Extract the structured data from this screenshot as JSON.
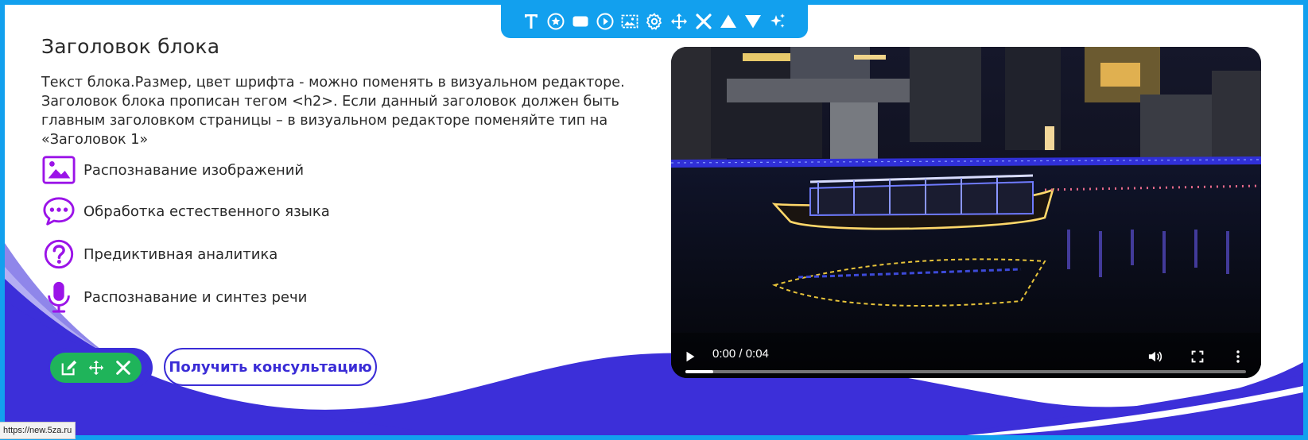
{
  "colors": {
    "accent": "#12a0ee",
    "purple": "#9b13e8",
    "wave": "#3c2fd9",
    "green": "#1fb45a"
  },
  "toolbar": {
    "icons": [
      "text-icon",
      "star-icon",
      "shape-icon",
      "play-icon",
      "image-icon",
      "gear-icon",
      "move-icon",
      "close-icon",
      "arrow-up-icon",
      "arrow-down-icon",
      "sparkle-icon"
    ]
  },
  "block": {
    "heading": "Заголовок блока",
    "text": "Текст блока.Размер, цвет шрифта - можно поменять в визуальном редакторе. Заголовок блока прописан тегом <h2>. Если данный заголовок должен быть главным заголовком страницы – в визуальном редакторе поменяйте тип на «Заголовок 1»"
  },
  "features": [
    {
      "icon": "image-icon",
      "label": "Распознавание изображений"
    },
    {
      "icon": "chat-icon",
      "label": "Обработка естественного языка"
    },
    {
      "icon": "question-icon",
      "label": "Предиктивная аналитика"
    },
    {
      "icon": "microphone-icon",
      "label": "Распознавание и синтез речи"
    }
  ],
  "edit_controls": {
    "icons": [
      "edit-icon",
      "move-icon",
      "close-icon"
    ]
  },
  "cta": {
    "label": "Получить консультацию"
  },
  "video": {
    "time": "0:00 / 0:04",
    "progress": 0.05
  },
  "status_bar": {
    "url": "https://new.5za.ru"
  }
}
